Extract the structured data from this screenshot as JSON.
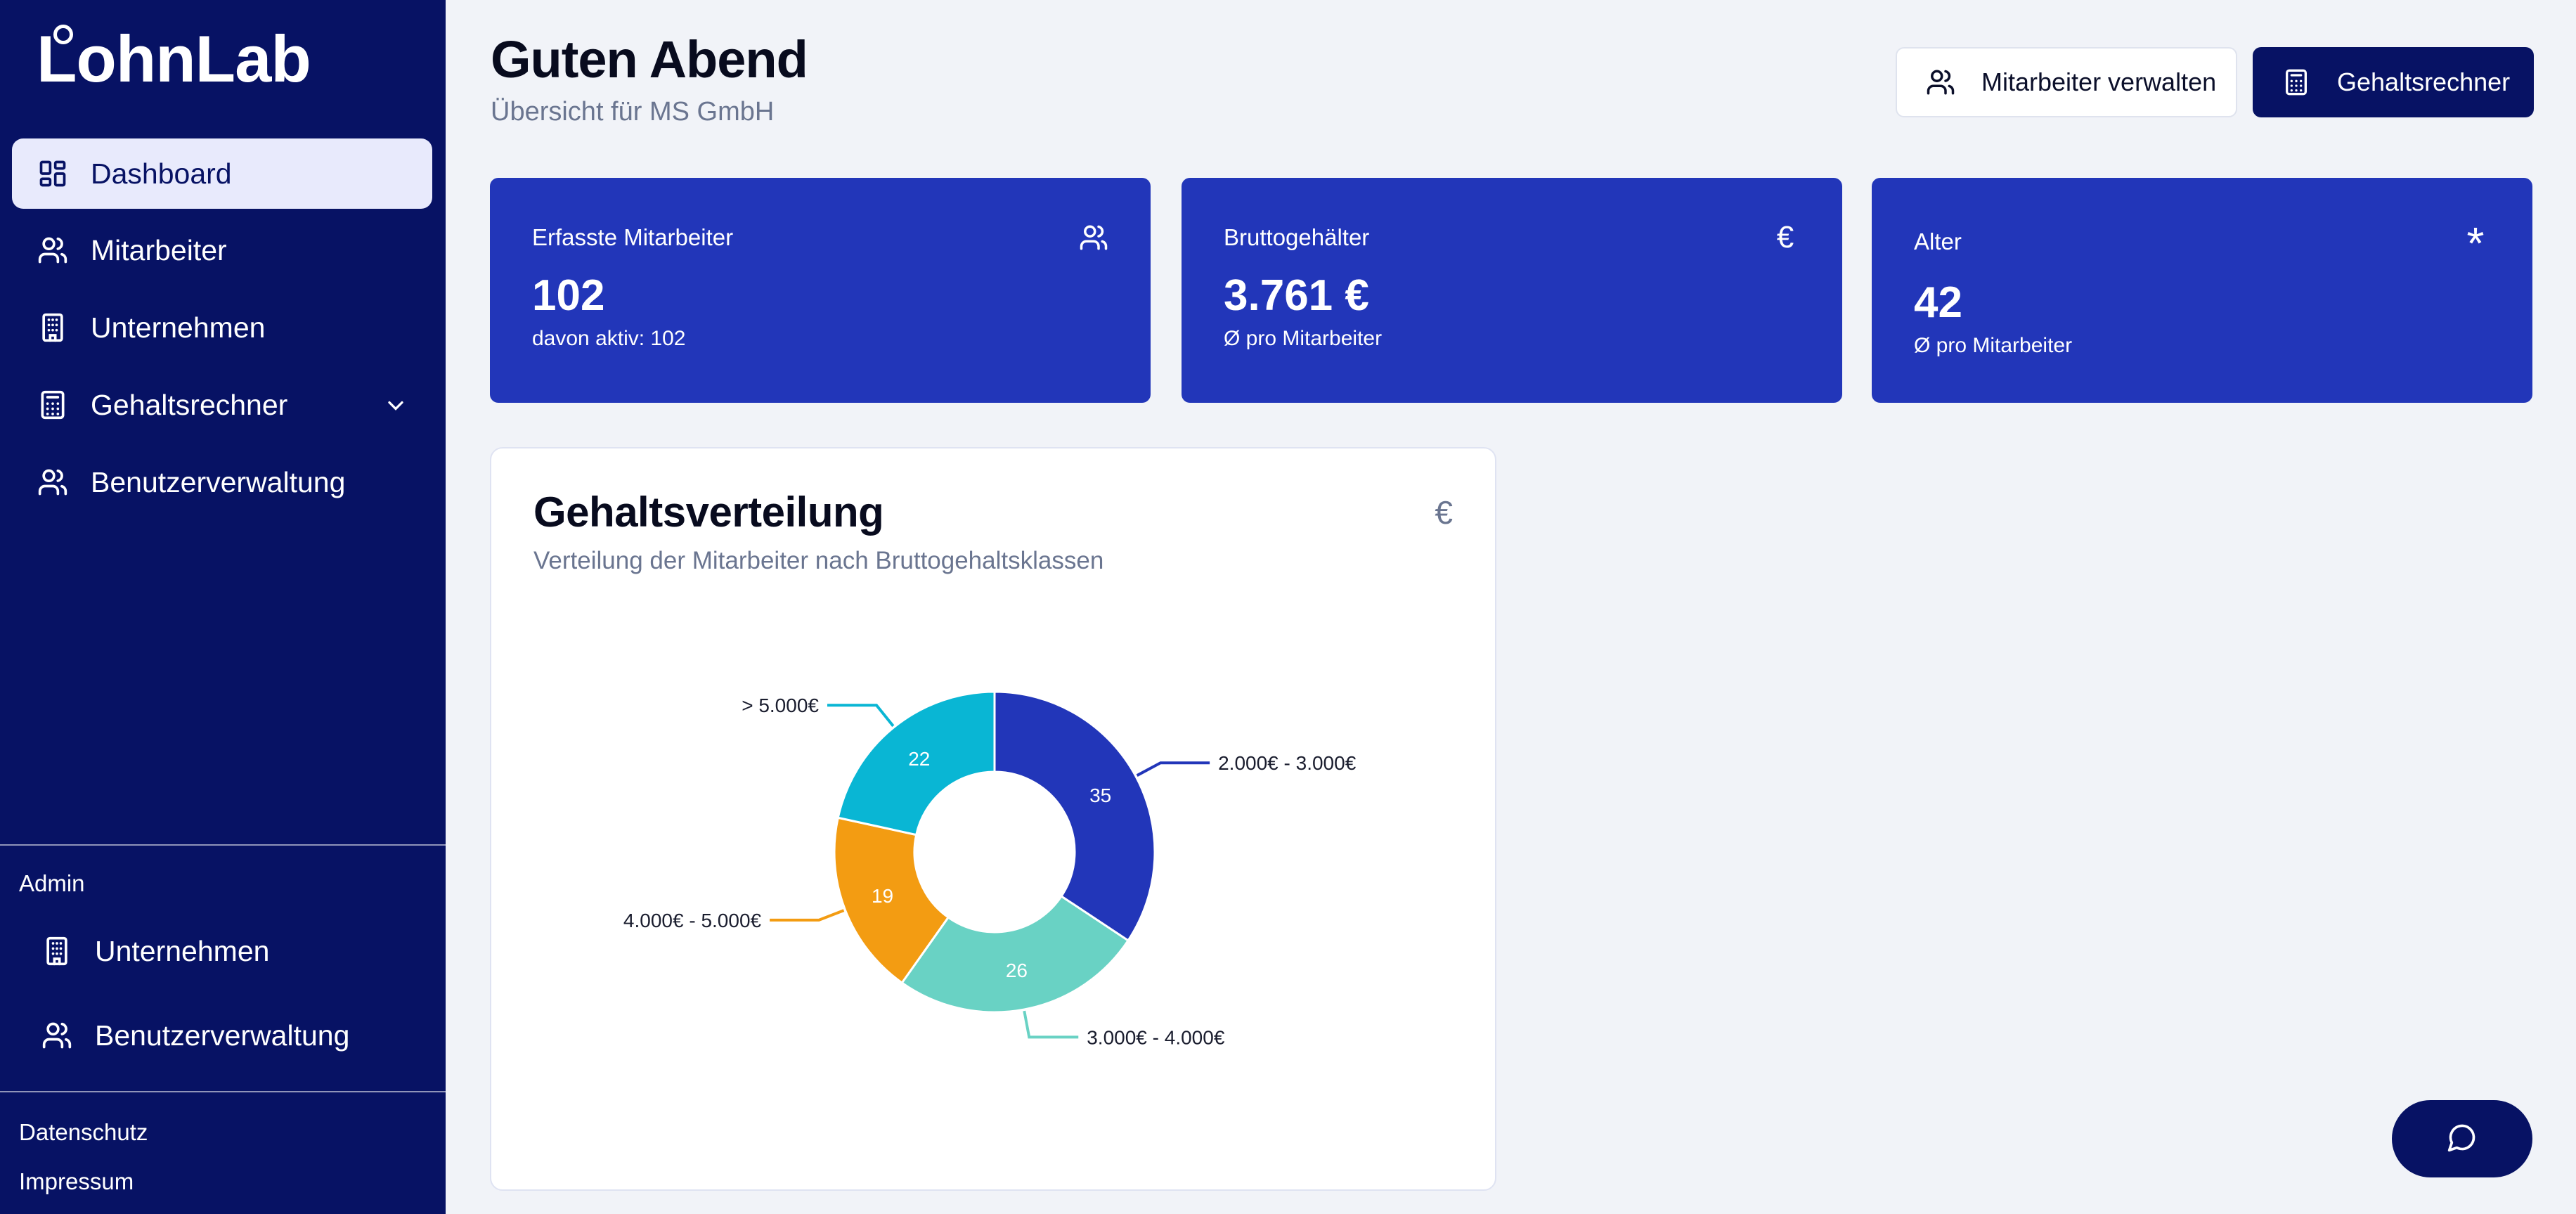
{
  "brand": {
    "name": "LohnLab"
  },
  "sidebar": {
    "items": [
      {
        "label": "Dashboard",
        "icon": "dashboard-icon",
        "active": true
      },
      {
        "label": "Mitarbeiter",
        "icon": "users-icon"
      },
      {
        "label": "Unternehmen",
        "icon": "building-icon"
      },
      {
        "label": "Gehaltsrechner",
        "icon": "calculator-icon",
        "has_submenu": true
      },
      {
        "label": "Benutzerverwaltung",
        "icon": "users-icon"
      }
    ],
    "admin": {
      "label": "Admin",
      "items": [
        {
          "label": "Unternehmen",
          "icon": "building-icon"
        },
        {
          "label": "Benutzerverwaltung",
          "icon": "users-icon"
        }
      ]
    },
    "footer": [
      {
        "label": "Datenschutz"
      },
      {
        "label": "Impressum"
      }
    ]
  },
  "header": {
    "greeting": "Guten Abend",
    "subtitle": "Übersicht für MS GmbH",
    "manage_button": "Mitarbeiter verwalten",
    "calculator_button": "Gehaltsrechner"
  },
  "stats": [
    {
      "title": "Erfasste Mitarbeiter",
      "value": "102",
      "sub": "davon aktiv: 102",
      "icon": "users-icon"
    },
    {
      "title": "Bruttogehälter",
      "value": "3.761 €",
      "sub": "Ø pro Mitarbeiter",
      "icon": "euro-icon",
      "icon_char": "€"
    },
    {
      "title": "Alter",
      "value": "42",
      "sub": "Ø pro Mitarbeiter",
      "icon": "asterisk-icon",
      "icon_char": "*"
    }
  ],
  "chart_card": {
    "title": "Gehaltsverteilung",
    "subtitle": "Verteilung der Mitarbeiter nach Bruttogehaltsklassen",
    "icon_char": "€"
  },
  "chart_data": {
    "type": "pie",
    "donut": true,
    "categories": [
      "2.000€ - 3.000€",
      "3.000€ - 4.000€",
      "4.000€ - 5.000€",
      "> 5.000€"
    ],
    "values": [
      35,
      26,
      19,
      22
    ],
    "colors": [
      "#2236b9",
      "#69d2c4",
      "#f39c12",
      "#09b6d4"
    ]
  },
  "colors": {
    "sidebar_bg": "#071264",
    "card_bg": "#2236b9",
    "active_item_bg": "#e8eafc",
    "page_bg": "#f1f3f8"
  },
  "chat_button": {
    "icon": "chat-bubble-icon"
  }
}
